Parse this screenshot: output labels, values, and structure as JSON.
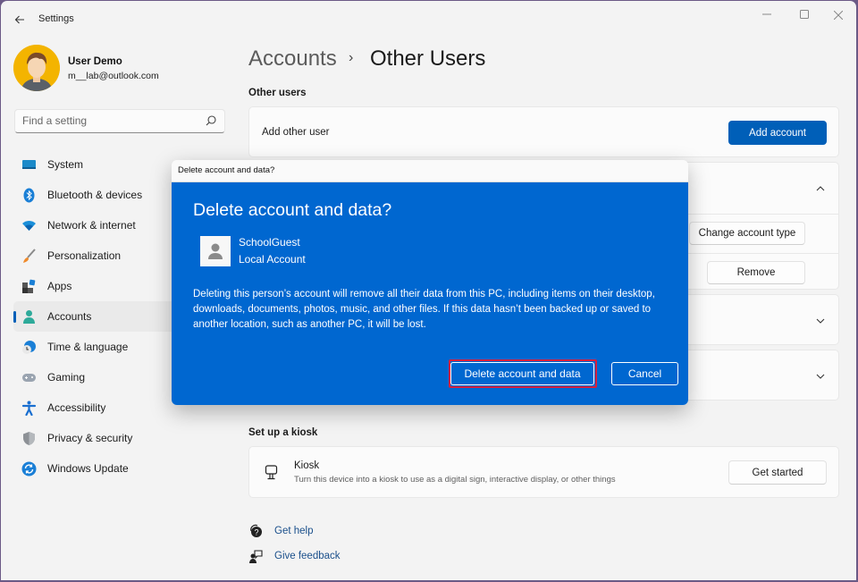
{
  "window": {
    "title": "Settings",
    "back_icon": "arrow-left-icon",
    "controls": {
      "minimize": "—",
      "maximize": "☐",
      "close": "✕"
    }
  },
  "profile": {
    "name": "User Demo",
    "email": "m__lab@outlook.com"
  },
  "search": {
    "placeholder": "Find a setting",
    "value": ""
  },
  "sidebar": {
    "items": [
      {
        "label": "System",
        "icon": "system-icon",
        "active": false
      },
      {
        "label": "Bluetooth & devices",
        "icon": "bluetooth-icon",
        "active": false
      },
      {
        "label": "Network & internet",
        "icon": "wifi-icon",
        "active": false
      },
      {
        "label": "Personalization",
        "icon": "paintbrush-icon",
        "active": false
      },
      {
        "label": "Apps",
        "icon": "apps-icon",
        "active": false
      },
      {
        "label": "Accounts",
        "icon": "accounts-icon",
        "active": true
      },
      {
        "label": "Time & language",
        "icon": "time-language-icon",
        "active": false
      },
      {
        "label": "Gaming",
        "icon": "gamepad-icon",
        "active": false
      },
      {
        "label": "Accessibility",
        "icon": "accessibility-icon",
        "active": false
      },
      {
        "label": "Privacy & security",
        "icon": "shield-icon",
        "active": false
      },
      {
        "label": "Windows Update",
        "icon": "windows-update-icon",
        "active": false
      }
    ]
  },
  "breadcrumb": {
    "parent": "Accounts",
    "separator": "›",
    "current": "Other Users"
  },
  "other_users": {
    "section_title": "Other users",
    "add_label": "Add other user",
    "add_button": "Add account",
    "change_type_button": "Change account type",
    "remove_button": "Remove"
  },
  "kiosk": {
    "section_title": "Set up a kiosk",
    "title": "Kiosk",
    "description": "Turn this device into a kiosk to use as a digital sign, interactive display, or other things",
    "button": "Get started"
  },
  "links": {
    "help": "Get help",
    "feedback": "Give feedback"
  },
  "dialog": {
    "window_title": "Delete account and data?",
    "heading": "Delete account and data?",
    "user_name": "SchoolGuest",
    "user_type": "Local Account",
    "message": "Deleting this person’s account will remove all their data from this PC, including items on their desktop, downloads, documents, photos, music, and other files. If this data hasn’t been backed up or saved to another location, such as another PC, it will be lost.",
    "delete_button": "Delete account and data",
    "cancel_button": "Cancel",
    "highlight_color": "#d5213f",
    "background_color": "#0067d0"
  },
  "colors": {
    "accent": "#005fb8",
    "window_bg": "#f3f3f3",
    "card_bg": "#fbfbfb"
  }
}
